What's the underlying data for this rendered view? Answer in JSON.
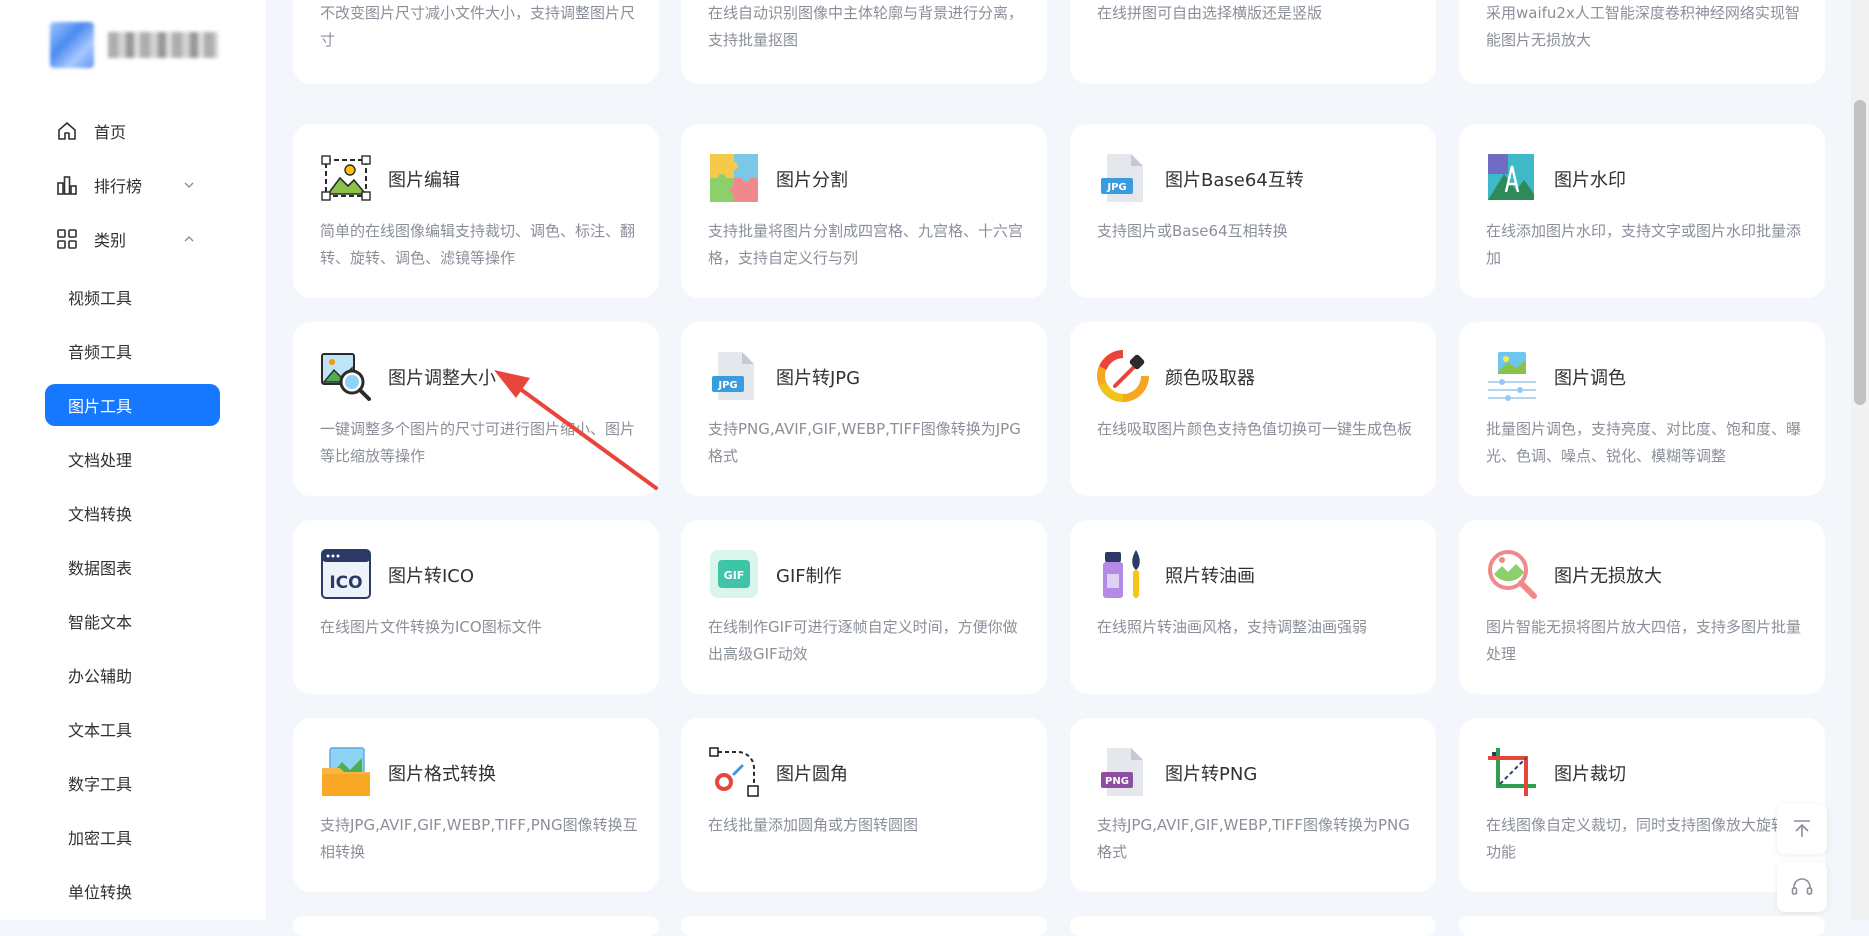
{
  "sidebar": {
    "nav": [
      {
        "label": "首页",
        "icon": "home-icon"
      },
      {
        "label": "排行榜",
        "icon": "bar-chart-icon",
        "chevron": "down"
      },
      {
        "label": "类别",
        "icon": "grid-icon",
        "chevron": "up"
      }
    ],
    "categories": [
      "视频工具",
      "音频工具",
      "图片工具",
      "文档处理",
      "文档转换",
      "数据图表",
      "智能文本",
      "办公辅助",
      "文本工具",
      "数字工具",
      "加密工具",
      "单位转换"
    ],
    "active_category": "图片工具"
  },
  "top_row": [
    {
      "desc": "不改变图片尺寸减小文件大小，支持调整图片尺寸"
    },
    {
      "desc": "在线自动识别图像中主体轮廓与背景进行分离，支持批量抠图"
    },
    {
      "desc": "在线拼图可自由选择横版还是竖版"
    },
    {
      "desc": "采用waifu2x人工智能深度卷积神经网络实现智能图片无损放大"
    }
  ],
  "tools": [
    {
      "title": "图片编辑",
      "desc": "简单的在线图像编辑支持裁切、调色、标注、翻转、旋转、调色、滤镜等操作",
      "icon": "image-edit-icon"
    },
    {
      "title": "图片分割",
      "desc": "支持批量将图片分割成四宫格、九宫格、十六宫格，支持自定义行与列",
      "icon": "puzzle-icon"
    },
    {
      "title": "图片Base64互转",
      "desc": "支持图片或Base64互相转换",
      "icon": "jpg-file-icon"
    },
    {
      "title": "图片水印",
      "desc": "在线添加图片水印，支持文字或图片水印批量添加",
      "icon": "watermark-icon"
    },
    {
      "title": "图片调整大小",
      "desc": "一键调整多个图片的尺寸可进行图片缩小、图片等比缩放等操作",
      "icon": "image-search-icon"
    },
    {
      "title": "图片转JPG",
      "desc": "支持PNG,AVIF,GIF,WEBP,TIFF图像转换为JPG格式",
      "icon": "jpg-file-icon"
    },
    {
      "title": "颜色吸取器",
      "desc": "在线吸取图片颜色支持色值切换可一键生成色板",
      "icon": "color-picker-icon"
    },
    {
      "title": "图片调色",
      "desc": "批量图片调色，支持亮度、对比度、饱和度、曝光、色调、噪点、锐化、模糊等调整",
      "icon": "adjust-icon"
    },
    {
      "title": "图片转ICO",
      "desc": "在线图片文件转换为ICO图标文件",
      "icon": "ico-icon"
    },
    {
      "title": "GIF制作",
      "desc": "在线制作GIF可进行逐帧自定义时间，方便你做出高级GIF动效",
      "icon": "gif-icon"
    },
    {
      "title": "照片转油画",
      "desc": "在线照片转油画风格，支持调整油画强弱",
      "icon": "paint-icon"
    },
    {
      "title": "图片无损放大",
      "desc": "图片智能无损将图片放大四倍，支持多图片批量处理",
      "icon": "magnifier-icon"
    },
    {
      "title": "图片格式转换",
      "desc": "支持JPG,AVIF,GIF,WEBP,TIFF,PNG图像转换互相转换",
      "icon": "folder-image-icon"
    },
    {
      "title": "图片圆角",
      "desc": "在线批量添加圆角或方图转圆图",
      "icon": "round-corner-icon"
    },
    {
      "title": "图片转PNG",
      "desc": "支持JPG,AVIF,GIF,WEBP,TIFF图像转换为PNG格式",
      "icon": "png-file-icon"
    },
    {
      "title": "图片裁切",
      "desc": "在线图像自定义裁切，同时支持图像放大旋转等功能",
      "icon": "crop-icon"
    }
  ],
  "file_labels": {
    "jpg": "JPG",
    "png": "PNG",
    "ico": "ICO",
    "gif": "GIF"
  },
  "colors": {
    "accent": "#1677ff",
    "bg": "#f3f6fa",
    "arrow": "#e8453c"
  }
}
